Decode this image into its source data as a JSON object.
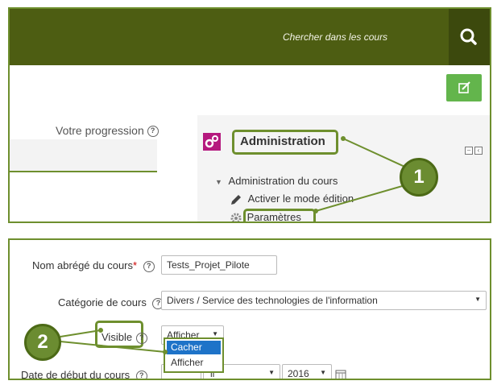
{
  "header": {
    "search_placeholder": "Chercher dans les cours"
  },
  "progress": {
    "label": "Votre progression"
  },
  "admin_block": {
    "title": "Administration",
    "tree": {
      "root": "Administration du cours",
      "items": [
        {
          "label": "Activer le mode édition",
          "icon": "pencil-icon"
        },
        {
          "label": "Paramètres",
          "icon": "gear-icon"
        }
      ]
    }
  },
  "form": {
    "short_name": {
      "label": "Nom abrégé du cours",
      "required_mark": "*",
      "value": "Tests_Projet_Pilote"
    },
    "category": {
      "label": "Catégorie de cours",
      "value": "Divers / Service des technologies de l'information"
    },
    "visible": {
      "label": "Visible",
      "value": "Afficher",
      "options": [
        "Cacher",
        "Afficher"
      ],
      "highlighted": "Cacher"
    },
    "start_date": {
      "label": "Date de début du cours",
      "month_partial": "il",
      "year": "2016"
    }
  },
  "callouts": [
    {
      "number": "1"
    },
    {
      "number": "2"
    }
  ],
  "colors": {
    "brand_bar": "#4d5d12",
    "accent_green": "#6e8f2e",
    "edit_button": "#63b54c",
    "admin_icon": "#b5197e",
    "dropdown_highlight": "#1e73c8"
  }
}
